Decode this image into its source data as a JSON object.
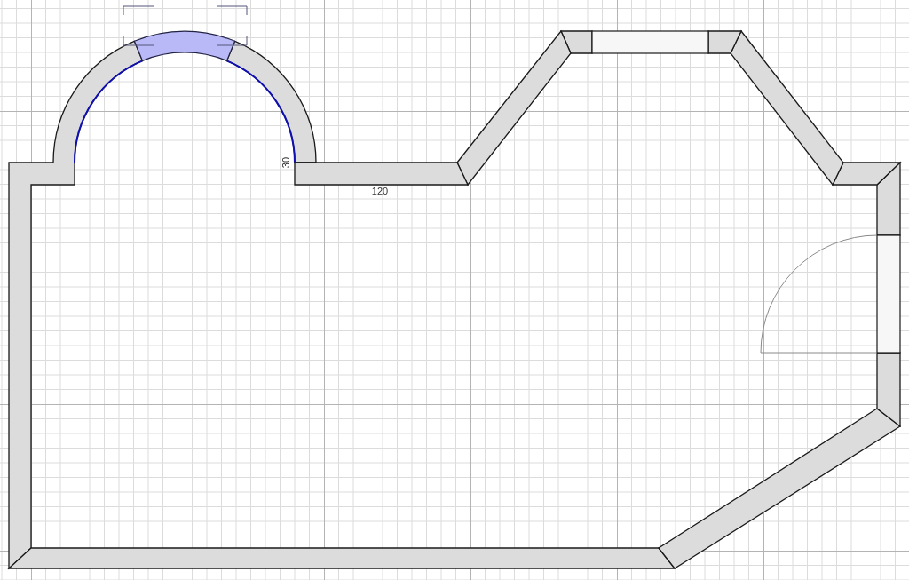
{
  "windows": [
    {
      "kind": "arch",
      "selected": true
    },
    {
      "kind": "flat",
      "selected": false
    }
  ],
  "door": {
    "kind": "swing"
  },
  "dimension_labels": [
    {
      "text": "30",
      "kind": "vertical"
    },
    {
      "text": "120",
      "kind": "horizontal"
    }
  ]
}
